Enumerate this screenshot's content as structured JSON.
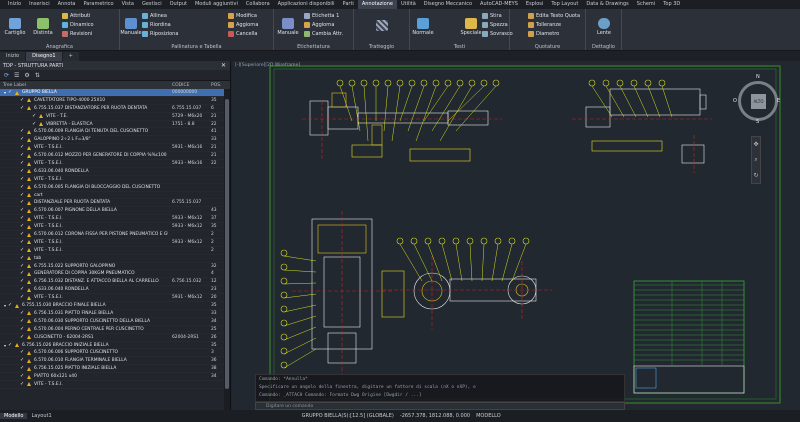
{
  "menu_tabs": [
    "Inizio",
    "Inserisci",
    "Annota",
    "Parametrico",
    "Vista",
    "Gestisci",
    "Output",
    "Moduli aggiuntivi",
    "Collabora",
    "Applicazioni disponibili",
    "Parti",
    "Annotazione",
    "Utilità",
    "Disegno Meccanico",
    "AutoCAD-MEYS",
    "Esplosi",
    "Top Layout",
    "Data & Drawings",
    "Schemi",
    "Top 3D"
  ],
  "active_menu_tab": "Annotazione",
  "ribbon": {
    "anagrafica": {
      "title": "Anagrafica",
      "cartiglio": "Cartiglio",
      "distinta": "Distinta",
      "attributi": "Attributi",
      "dinamico": "Dinamico",
      "revisioni": "Revisioni"
    },
    "pallinatura": {
      "title": "Pallinatura e Tabella",
      "manuale": "Manuale",
      "allinea": "Allinea",
      "riordina": "Riordina",
      "riposiziona": "Riposiziona",
      "modifica": "Modifica",
      "aggiorna": "Aggiorna",
      "cancella": "Cancella"
    },
    "etichettatura": {
      "title": "Etichettatura",
      "manuale": "Manuale",
      "etichetta": "Etichetta 1",
      "aggiorna": "Aggiorna",
      "cambia": "Cambia Attr."
    },
    "tratteggio": {
      "title": "Tratteggio"
    },
    "testi": {
      "title": "Testi",
      "normale": "Normale",
      "speciale": "Speciale",
      "stira": "Stira",
      "spezza": "Spezza",
      "sovrasco": "Sovrasco"
    },
    "quotature": {
      "title": "Quotature",
      "edita": "Edita Testo Quota",
      "tolleranze": "Tolleranze",
      "diametro": "Diametro"
    },
    "dettaglio": {
      "title": "Dettaglio",
      "lente": "Lente"
    }
  },
  "doc_tabs": [
    "Inizio",
    "Disegno1"
  ],
  "active_doc_tab": "Disegno1",
  "panel": {
    "title": "TDP - STRUTTURA PARTI",
    "columns": {
      "tree": "Tree Label",
      "code": "CODICE",
      "pos": "POS."
    },
    "rows": [
      {
        "indent": 0,
        "label": "GRUPPO BIELLA",
        "code": "000000000",
        "pos": "",
        "selected": true
      },
      {
        "indent": 1,
        "label": "CAVETTATORE TIPO-4000 25X10",
        "code": "",
        "pos": "35"
      },
      {
        "indent": 1,
        "label": "6.755.15.037 DISTANZIATORE PER RUOTA DENTATA",
        "code": "6.755.15.037",
        "pos": "6"
      },
      {
        "indent": 2,
        "label": "VITE - T.E.",
        "code": "5729 - M6x20",
        "pos": "21"
      },
      {
        "indent": 2,
        "label": "VIBRETTA - ELASTICA",
        "code": "1751 - 8.8",
        "pos": "22"
      },
      {
        "indent": 1,
        "label": "6.570.06.009 FLANGIA DI TENUTA DEL CUSCINETTO",
        "code": "",
        "pos": "41"
      },
      {
        "indent": 1,
        "label": "GALOPPINO 2÷2 L F=3/8\"",
        "code": "",
        "pos": "33"
      },
      {
        "indent": 1,
        "label": "VITE - T.S.E.I.",
        "code": "5931 - M6x16",
        "pos": "21"
      },
      {
        "indent": 1,
        "label": "6.570.06.012 MOZZO PER GENERATORE DI COPPIA %%c100 P...",
        "code": "",
        "pos": "21"
      },
      {
        "indent": 1,
        "label": "VITE - T.S.E.I.",
        "code": "5933 - M6x16",
        "pos": "22"
      },
      {
        "indent": 1,
        "label": "6.633.06.040 RONDELLA",
        "code": "",
        "pos": ""
      },
      {
        "indent": 1,
        "label": "VITE - T.S.E.I.",
        "code": "",
        "pos": ""
      },
      {
        "indent": 1,
        "label": "6.570.06.005 FLANGIA DI BLOCCAGGIO DEL CUSCINETTO",
        "code": "",
        "pos": ""
      },
      {
        "indent": 1,
        "label": "cart",
        "code": "",
        "pos": ""
      },
      {
        "indent": 1,
        "label": "DISTANZIALE PER RUOTA DENTATA",
        "code": "6.755.15.037",
        "pos": ""
      },
      {
        "indent": 1,
        "label": "6.570.06.007 PIGNONE DELLA BIELLA",
        "code": "",
        "pos": "43"
      },
      {
        "indent": 1,
        "label": "VITE - T.S.E.I.",
        "code": "5933 - M6x12",
        "pos": "37"
      },
      {
        "indent": 1,
        "label": "VITE - T.S.E.I.",
        "code": "5933 - M6x12",
        "pos": "35"
      },
      {
        "indent": 1,
        "label": "6.570.06.012 CORONA FISSA PER PISTONE PNEUMATICO E GUIDE ...",
        "code": "",
        "pos": "2"
      },
      {
        "indent": 1,
        "label": "VITE - T.S.E.I.",
        "code": "5933 - M6x12",
        "pos": "2"
      },
      {
        "indent": 1,
        "label": "VITE - T.S.E.I.",
        "code": "",
        "pos": "2"
      },
      {
        "indent": 1,
        "label": "tab",
        "code": "",
        "pos": ""
      },
      {
        "indent": 1,
        "label": "6.755.15.022 SUPPORTO GALOPPINO",
        "code": "",
        "pos": "32"
      },
      {
        "indent": 1,
        "label": "GENERATORE DI COPPIA 30KGM PNEUMATICO",
        "code": "",
        "pos": "4"
      },
      {
        "indent": 1,
        "label": "6.756.15.032 DISTANZ. E ATTACCO BIELLA AL CARRELLO",
        "code": "6.756.15.032",
        "pos": "12"
      },
      {
        "indent": 1,
        "label": "6.633.06.040 RONDELLA",
        "code": "",
        "pos": "23"
      },
      {
        "indent": 1,
        "label": "VITE - T.S.E.I.",
        "code": "5931 - M6x12",
        "pos": "20"
      },
      {
        "indent": 0,
        "label": "6.755.15.030 BRACCIO FINALE BIELLA",
        "code": "",
        "pos": "35"
      },
      {
        "indent": 1,
        "label": "6.756.15.031 PIATTO FINALE BIELLA",
        "code": "",
        "pos": "33"
      },
      {
        "indent": 1,
        "label": "6.570.06.030 SUPPORTO CUSCINETTO DELLA BIELLA",
        "code": "",
        "pos": "34"
      },
      {
        "indent": 1,
        "label": "6.570.06.004 PERNO CENTRALE PER CUSCINETTO",
        "code": "",
        "pos": "25"
      },
      {
        "indent": 1,
        "label": "CUSCINETTO - 62004-2RS1",
        "code": "62004-2RS1",
        "pos": "26"
      },
      {
        "indent": 0,
        "label": "6.756.15.026 BRACCIO INIZIALE BIELLA",
        "code": "",
        "pos": "35"
      },
      {
        "indent": 1,
        "label": "6.570.06.006 SUPPORTO CUSCINETTO",
        "code": "",
        "pos": "3"
      },
      {
        "indent": 1,
        "label": "6.570.06.010 FLANGIA TERMINALE BIELLA",
        "code": "",
        "pos": "36"
      },
      {
        "indent": 1,
        "label": "6.756.15.025 PIATTO INIZIALE BIELLA",
        "code": "",
        "pos": "38"
      },
      {
        "indent": 1,
        "label": "PIATTO 60x121 x40",
        "code": "",
        "pos": "34"
      },
      {
        "indent": 1,
        "label": "VITE - T.S.E.I.",
        "code": "",
        "pos": ""
      }
    ]
  },
  "viewcube": {
    "top_label": "ALTO",
    "n": "N",
    "e": "E",
    "w": "O",
    "s": "S"
  },
  "viewport_label": "[-][Superiore][2D Wireframe]",
  "cmdline": {
    "lines": [
      "Comando: *Annulla*",
      "Specificare un angolo della finestra, digitare un fattore di scala (nX o nXP), o",
      "Comando: _ATTACH Comando: Formato Dwg Origine [Dwgdir / ...]"
    ],
    "input_placeholder": "Digitare un comando"
  },
  "statusbar": {
    "tabs": [
      "Modello",
      "Layout1"
    ],
    "active": "Modello",
    "layer": "GRUPPO BIELLA(S):[12.5] (GLOBALE)",
    "coords": "-2657.378, 1812.088, 0.000",
    "mode": "MODELLO"
  }
}
